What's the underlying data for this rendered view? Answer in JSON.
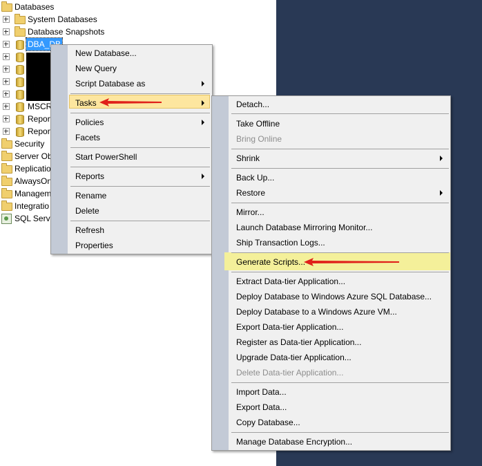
{
  "tree": {
    "root": "Databases",
    "system_databases": "System Databases",
    "database_snapshots": "Database Snapshots",
    "selected_db": "DBA_DB",
    "mscr": "MSCR",
    "report1": "Report",
    "report2": "Report",
    "security": "Security",
    "server_objects": "Server Obj",
    "replication": "Replication",
    "alwayson": "AlwaysOn",
    "management": "Managem",
    "integration": "Integratio",
    "sql_server_agent": "SQL Serve"
  },
  "context_menu": {
    "new_database": "New Database...",
    "new_query": "New Query",
    "script_database_as": "Script Database as",
    "tasks": "Tasks",
    "policies": "Policies",
    "facets": "Facets",
    "start_powershell": "Start PowerShell",
    "reports": "Reports",
    "rename": "Rename",
    "delete": "Delete",
    "refresh": "Refresh",
    "properties": "Properties"
  },
  "tasks_menu": {
    "detach": "Detach...",
    "take_offline": "Take Offline",
    "bring_online": "Bring Online",
    "shrink": "Shrink",
    "back_up": "Back Up...",
    "restore": "Restore",
    "mirror": "Mirror...",
    "launch_mirroring_monitor": "Launch Database Mirroring Monitor...",
    "ship_transaction_logs": "Ship Transaction Logs...",
    "generate_scripts": "Generate Scripts...",
    "extract_data_tier": "Extract Data-tier Application...",
    "deploy_azure_sql": "Deploy Database to Windows Azure SQL Database...",
    "deploy_azure_vm": "Deploy Database to a Windows Azure VM...",
    "export_data_tier": "Export Data-tier Application...",
    "register_data_tier": "Register as Data-tier Application...",
    "upgrade_data_tier": "Upgrade Data-tier Application...",
    "delete_data_tier": "Delete Data-tier Application...",
    "import_data": "Import Data...",
    "export_data": "Export Data...",
    "copy_database": "Copy Database...",
    "manage_encryption": "Manage Database Encryption..."
  },
  "colors": {
    "background_right": "#293955",
    "menu_bg": "#f0f0f0",
    "menu_gutter": "#c3cad6",
    "tasks_highlight": "#fde69f",
    "generate_highlight": "#f4f09a",
    "arrow_red": "#e0201a",
    "selection": "#3399ff"
  }
}
